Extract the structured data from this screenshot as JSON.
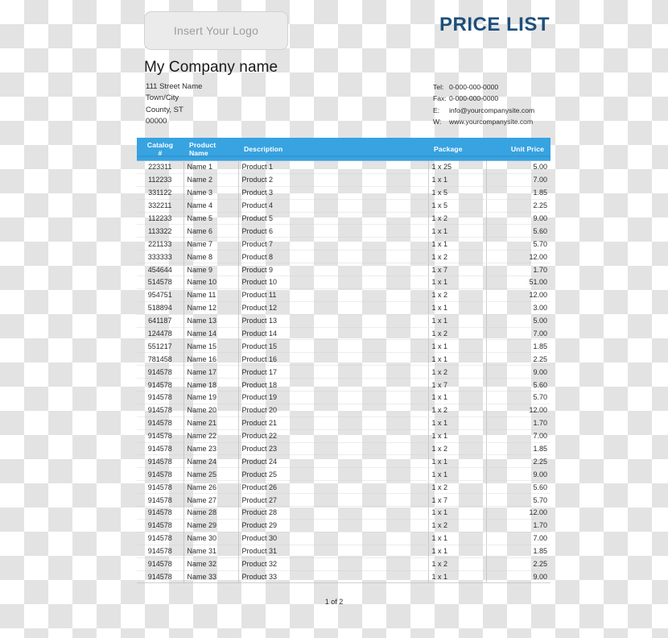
{
  "document": {
    "title": "PRICE LIST",
    "logo_placeholder": "Insert Your Logo",
    "company_name": "My Company name",
    "footer": "1 of 2"
  },
  "address": {
    "line1": "111 Street Name",
    "line2": "Town/City",
    "line3": "County, ST",
    "line4": "00000"
  },
  "contact": {
    "tel_label": "Tel:",
    "tel_value": "0-000-000-0000",
    "fax_label": "Fax:",
    "fax_value": "0-000-000-0000",
    "email_label": "E:",
    "email_value": "info@yourcompanysite.com",
    "web_label": "W:",
    "web_value": "www.yourcompanysite.com"
  },
  "colors": {
    "title_blue": "#1d4f7c",
    "header_blue": "#37a3e1",
    "logo_fill": "#ebebeb",
    "logo_border": "#d2d2d2",
    "text": "#2b2b2b"
  },
  "table": {
    "columns": [
      {
        "key": "catalog",
        "label_line1": "Catalog",
        "label_line2": "#"
      },
      {
        "key": "name",
        "label_line1": "Product Name",
        "label_line2": ""
      },
      {
        "key": "description",
        "label_line1": "Description",
        "label_line2": ""
      },
      {
        "key": "package",
        "label_line1": "Package",
        "label_line2": ""
      },
      {
        "key": "unit_price",
        "label_line1": "Unit Price",
        "label_line2": ""
      }
    ],
    "rows": [
      {
        "catalog": "223311",
        "name": "Name 1",
        "description": "Product 1",
        "package": "1 x 25",
        "unit_price": "5.00"
      },
      {
        "catalog": "112233",
        "name": "Name 2",
        "description": "Product 2",
        "package": "1 x 1",
        "unit_price": "7.00"
      },
      {
        "catalog": "331122",
        "name": "Name 3",
        "description": "Product 3",
        "package": "1 x 5",
        "unit_price": "1.85"
      },
      {
        "catalog": "332211",
        "name": "Name 4",
        "description": "Product 4",
        "package": "1 x 5",
        "unit_price": "2.25"
      },
      {
        "catalog": "112233",
        "name": "Name 5",
        "description": "Product 5",
        "package": "1 x 2",
        "unit_price": "9.00"
      },
      {
        "catalog": "113322",
        "name": "Name 6",
        "description": "Product 6",
        "package": "1 x 1",
        "unit_price": "5.60"
      },
      {
        "catalog": "221133",
        "name": "Name 7",
        "description": "Product 7",
        "package": "1 x 1",
        "unit_price": "5.70"
      },
      {
        "catalog": "333333",
        "name": "Name 8",
        "description": "Product 8",
        "package": "1 x 2",
        "unit_price": "12.00"
      },
      {
        "catalog": "454644",
        "name": "Name 9",
        "description": "Product 9",
        "package": "1 x 7",
        "unit_price": "1.70"
      },
      {
        "catalog": "514578",
        "name": "Name 10",
        "description": "Product 10",
        "package": "1 x 1",
        "unit_price": "51.00"
      },
      {
        "catalog": "954751",
        "name": "Name 11",
        "description": "Product 11",
        "package": "1 x 2",
        "unit_price": "12.00"
      },
      {
        "catalog": "518894",
        "name": "Name 12",
        "description": "Product 12",
        "package": "1 x 1",
        "unit_price": "3.00"
      },
      {
        "catalog": "641187",
        "name": "Name 13",
        "description": "Product 13",
        "package": "1 x 1",
        "unit_price": "5.00"
      },
      {
        "catalog": "124478",
        "name": "Name 14",
        "description": "Product 14",
        "package": "1 x 2",
        "unit_price": "7.00"
      },
      {
        "catalog": "551217",
        "name": "Name 15",
        "description": "Product 15",
        "package": "1 x 1",
        "unit_price": "1.85"
      },
      {
        "catalog": "781458",
        "name": "Name 16",
        "description": "Product 16",
        "package": "1 x 1",
        "unit_price": "2.25"
      },
      {
        "catalog": "914578",
        "name": "Name 17",
        "description": "Product 17",
        "package": "1 x 2",
        "unit_price": "9.00"
      },
      {
        "catalog": "914578",
        "name": "Name 18",
        "description": "Product 18",
        "package": "1 x 7",
        "unit_price": "5.60"
      },
      {
        "catalog": "914578",
        "name": "Name 19",
        "description": "Product 19",
        "package": "1 x 1",
        "unit_price": "5.70"
      },
      {
        "catalog": "914578",
        "name": "Name 20",
        "description": "Product 20",
        "package": "1 x 2",
        "unit_price": "12.00"
      },
      {
        "catalog": "914578",
        "name": "Name 21",
        "description": "Product 21",
        "package": "1 x 1",
        "unit_price": "1.70"
      },
      {
        "catalog": "914578",
        "name": "Name 22",
        "description": "Product 22",
        "package": "1 x 1",
        "unit_price": "7.00"
      },
      {
        "catalog": "914578",
        "name": "Name 23",
        "description": "Product 23",
        "package": "1 x 2",
        "unit_price": "1.85"
      },
      {
        "catalog": "914578",
        "name": "Name 24",
        "description": "Product 24",
        "package": "1 x 1",
        "unit_price": "2.25"
      },
      {
        "catalog": "914578",
        "name": "Name 25",
        "description": "Product 25",
        "package": "1 x 1",
        "unit_price": "9.00"
      },
      {
        "catalog": "914578",
        "name": "Name 26",
        "description": "Product 26",
        "package": "1 x 2",
        "unit_price": "5.60"
      },
      {
        "catalog": "914578",
        "name": "Name 27",
        "description": "Product 27",
        "package": "1 x 7",
        "unit_price": "5.70"
      },
      {
        "catalog": "914578",
        "name": "Name 28",
        "description": "Product 28",
        "package": "1 x 1",
        "unit_price": "12.00"
      },
      {
        "catalog": "914578",
        "name": "Name 29",
        "description": "Product 29",
        "package": "1 x 2",
        "unit_price": "1.70"
      },
      {
        "catalog": "914578",
        "name": "Name 30",
        "description": "Product 30",
        "package": "1 x 1",
        "unit_price": "7.00"
      },
      {
        "catalog": "914578",
        "name": "Name 31",
        "description": "Product 31",
        "package": "1 x 1",
        "unit_price": "1.85"
      },
      {
        "catalog": "914578",
        "name": "Name 32",
        "description": "Product 32",
        "package": "1 x 2",
        "unit_price": "2.25"
      },
      {
        "catalog": "914578",
        "name": "Name 33",
        "description": "Product 33",
        "package": "1 x 1",
        "unit_price": "9.00"
      }
    ]
  }
}
